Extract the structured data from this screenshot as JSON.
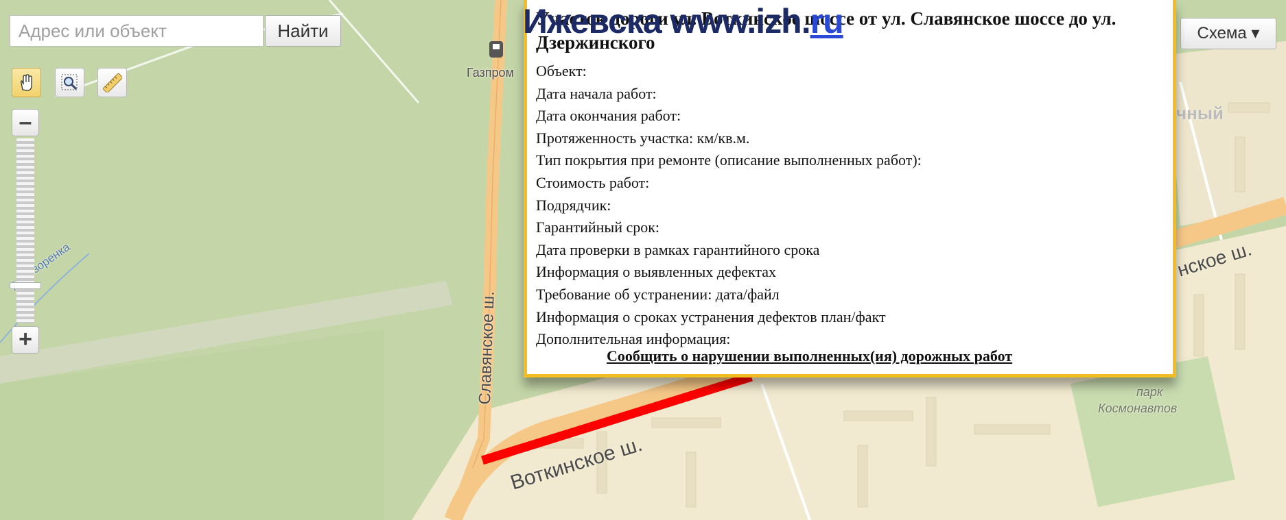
{
  "toolbar": {
    "search_placeholder": "Адрес или объект",
    "find_label": "Найти",
    "tools": [
      "hand-tool",
      "zoom-rectangle-tool",
      "ruler-tool"
    ],
    "active_tool": "hand-tool",
    "zoom_minus": "–",
    "zoom_plus": "+",
    "scheme_label": "Схема ▾"
  },
  "map": {
    "labels": {
      "gas_station": "Газпром",
      "river": "р. Позоренка",
      "slavyanskoe": "Славянское ш.",
      "votkinskoe_left": "Воткинское ш.",
      "votkinskoe_right": "нское ш.",
      "district": "чный",
      "park_line1": "парк",
      "park_line2": "Космонавтов"
    },
    "colors": {
      "forest": "#c4d6a8",
      "urban": "#f2ead0",
      "road": "#f6c888",
      "highlight_segment": "#ff0000"
    }
  },
  "watermark": {
    "text": "Ижевска www.izh.",
    "suffix": "ru"
  },
  "popup": {
    "title": "Участок дороги ул. Воткинское шоссе от ул. Славянское шоссе до ул. Дзержинского",
    "fields": [
      "Объект:",
      "Дата начала работ:",
      "Дата окончания работ:",
      "Протяженность участка: км/кв.м.",
      "Тип покрытия при ремонте (описание выполненных работ):",
      "Стоимость работ:",
      "Подрядчик:",
      "Гарантийный срок:",
      "Дата проверки в рамках гарантийного срока",
      "Информация о выявленных дефектах",
      "Требование об устранении: дата/файл",
      "Информация о сроках устранения дефектов план/факт",
      "Дополнительная информация:"
    ],
    "report_link": "Сообщить о нарушении выполненных(ия) дорожных работ",
    "border_color": "#f2bd22"
  }
}
